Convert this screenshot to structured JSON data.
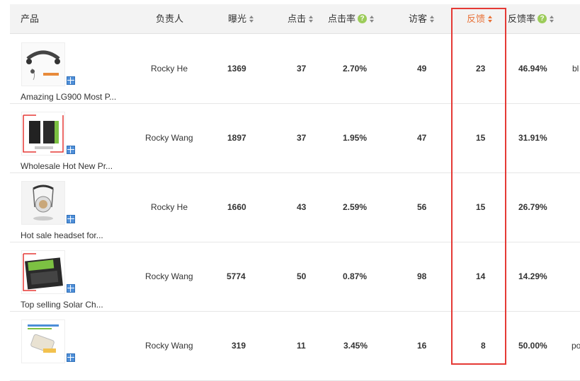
{
  "table": {
    "headers": {
      "product": "产品",
      "owner": "负责人",
      "exposure": "曝光",
      "clicks": "点击",
      "ctr": "点击率",
      "visitors": "访客",
      "feedback": "反馈",
      "feedback_rate": "反馈率"
    },
    "help_glyph": "?",
    "rows": [
      {
        "product": "Amazing LG900 Most P...",
        "owner": "Rocky He",
        "exposure": "1369",
        "clicks": "37",
        "ctr": "2.70%",
        "visitors": "49",
        "feedback": "23",
        "feedback_rate": "46.94%",
        "extra": "bl"
      },
      {
        "product": "Wholesale Hot New Pr...",
        "owner": "Rocky Wang",
        "exposure": "1897",
        "clicks": "37",
        "ctr": "1.95%",
        "visitors": "47",
        "feedback": "15",
        "feedback_rate": "31.91%",
        "extra": ""
      },
      {
        "product": "Hot sale headset for...",
        "owner": "Rocky He",
        "exposure": "1660",
        "clicks": "43",
        "ctr": "2.59%",
        "visitors": "56",
        "feedback": "15",
        "feedback_rate": "26.79%",
        "extra": ""
      },
      {
        "product": "Top selling Solar Ch...",
        "owner": "Rocky Wang",
        "exposure": "5774",
        "clicks": "50",
        "ctr": "0.87%",
        "visitors": "98",
        "feedback": "14",
        "feedback_rate": "14.29%",
        "extra": ""
      },
      {
        "product": "",
        "owner": "Rocky Wang",
        "exposure": "319",
        "clicks": "11",
        "ctr": "3.45%",
        "visitors": "16",
        "feedback": "8",
        "feedback_rate": "50.00%",
        "extra": "po"
      }
    ]
  },
  "colors": {
    "accent": "#e8733a",
    "highlight_border": "#e53935",
    "help_badge": "#9ccc5a"
  },
  "icons": {
    "sort": "sort-updown-icon",
    "help": "question-circle-icon",
    "view": "grid-view-icon"
  }
}
